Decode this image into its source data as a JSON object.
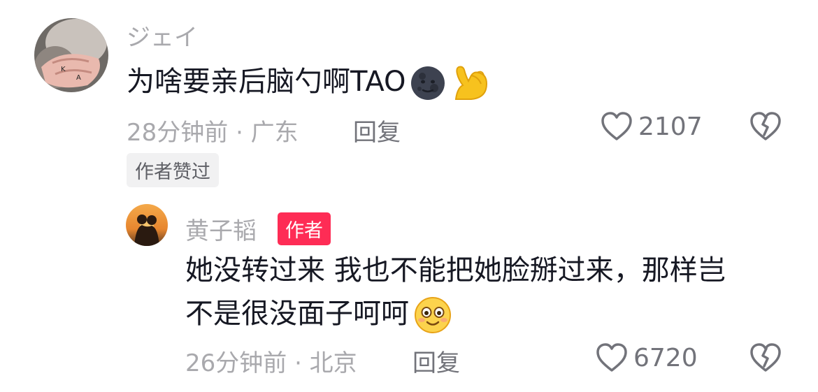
{
  "comments": [
    {
      "username": "ジェイ",
      "text": "为啥要亲后脑勺啊TAO",
      "emojis": [
        "new-moon-face-icon",
        "flexed-biceps-icon"
      ],
      "time_location": "28分钟前 · 广东",
      "reply_label": "回复",
      "like_count": "2107",
      "author_liked_badge": "作者赞过"
    }
  ],
  "replies": [
    {
      "username": "黄子韬",
      "author_badge": "作者",
      "text_line1": "她没转过来 我也不能把她脸掰过来，那样岂",
      "text_line2": "不是很没面子呵呵",
      "emojis": [
        "flushed-smile-icon"
      ],
      "time_location": "26分钟前 · 北京",
      "reply_label": "回复",
      "like_count": "6720"
    }
  ],
  "colors": {
    "author_badge_bg": "#fe2c55",
    "secondary_text": "#a9a9ad",
    "primary_text": "#161823"
  }
}
